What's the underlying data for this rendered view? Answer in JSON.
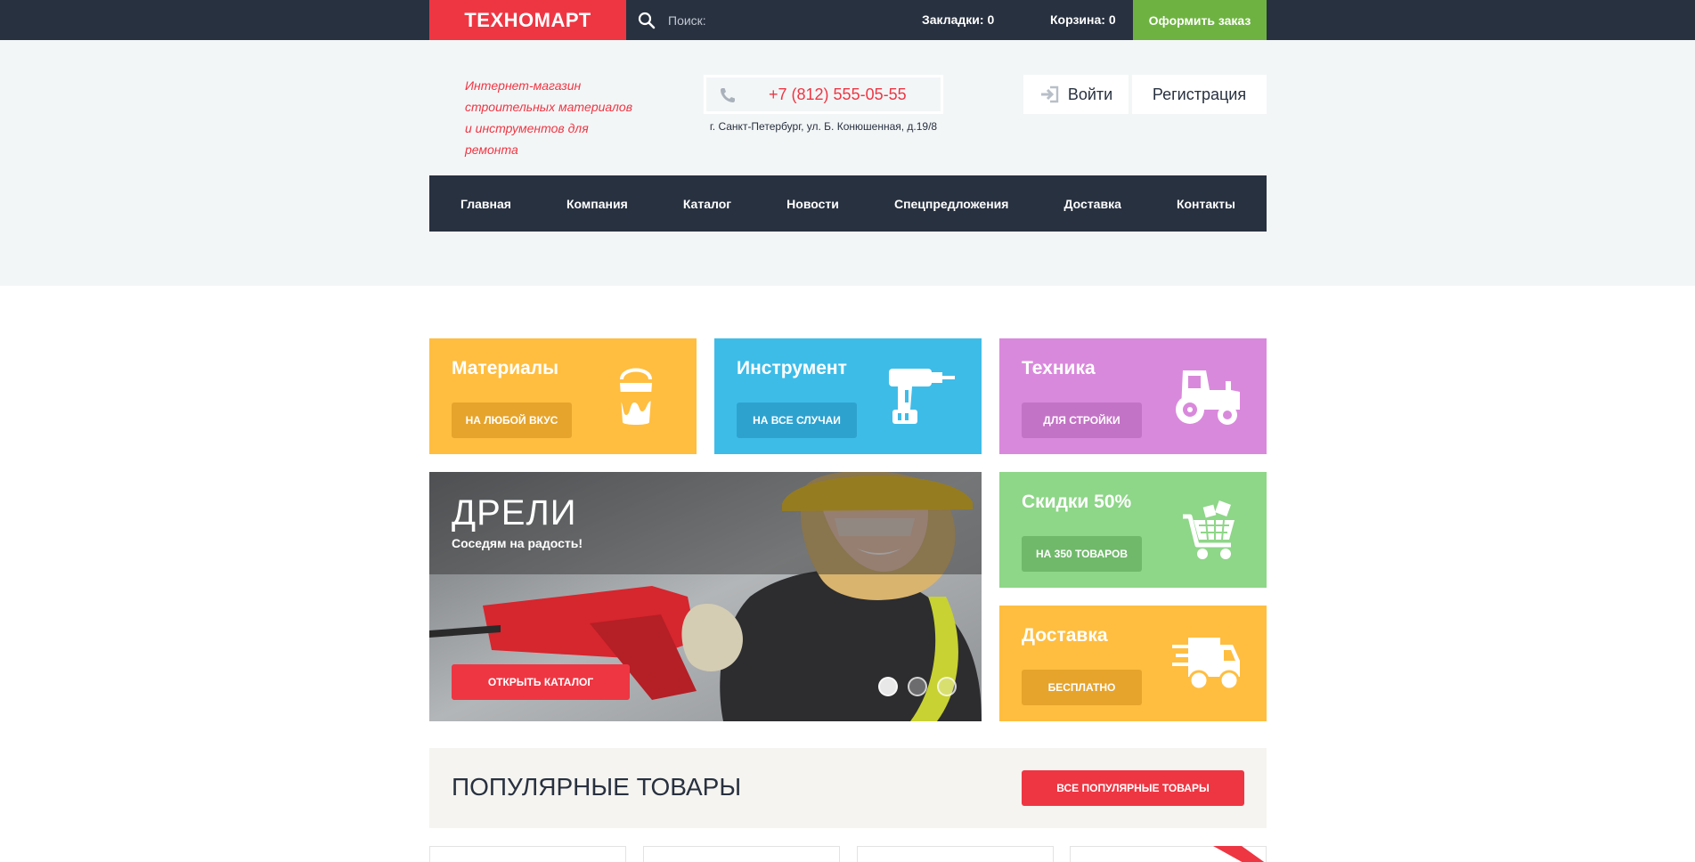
{
  "topbar": {
    "logo": "ТЕХНОМАРТ",
    "search_placeholder": "Поиск:",
    "bookmarks": "Закладки: 0",
    "cart": "Корзина: 0",
    "order_button": "Оформить заказ"
  },
  "header": {
    "tagline": "Интернет-магазин строительных материалов и инструментов для ремонта",
    "phone": "+7 (812) 555-05-55",
    "address": "г. Санкт-Петербург, ул. Б. Конюшенная, д.19/8",
    "login": "Войти",
    "register": "Регистрация"
  },
  "nav": {
    "items": [
      "Главная",
      "Компания",
      "Каталог",
      "Новости",
      "Спецпредложения",
      "Доставка",
      "Контакты"
    ]
  },
  "tiles": {
    "materials": {
      "title": "Материалы",
      "button": "НА ЛЮБОЙ ВКУС",
      "icon": "paint-bucket-icon"
    },
    "tools": {
      "title": "Инструмент",
      "button": "НА ВСЕ СЛУЧАИ",
      "icon": "drill-icon"
    },
    "machinery": {
      "title": "Техника",
      "button": "ДЛЯ СТРОЙКИ",
      "icon": "tractor-icon"
    },
    "sale": {
      "title": "Скидки 50%",
      "button": "НА 350 ТОВАРОВ",
      "icon": "shopping-cart-icon"
    },
    "delivery": {
      "title": "Доставка",
      "button": "БЕСПЛАТНО",
      "icon": "truck-icon"
    }
  },
  "slider": {
    "title": "ДРЕЛИ",
    "subtitle": "Соседям на радость!",
    "button": "ОТКРЫТЬ КАТАЛОГ",
    "slides_count": 3,
    "active_slide": 1
  },
  "popular": {
    "title": "ПОПУЛЯРНЫЕ ТОВАРЫ",
    "button": "ВСЕ ПОПУЛЯРНЫЕ ТОВАРЫ"
  },
  "colors": {
    "accent_red": "#ee3643",
    "dark_navy": "#283140",
    "green": "#6eb341",
    "yellow": "#ffbe40",
    "blue": "#3ebce8",
    "violet": "#d989dc",
    "light_green": "#8ed688"
  }
}
